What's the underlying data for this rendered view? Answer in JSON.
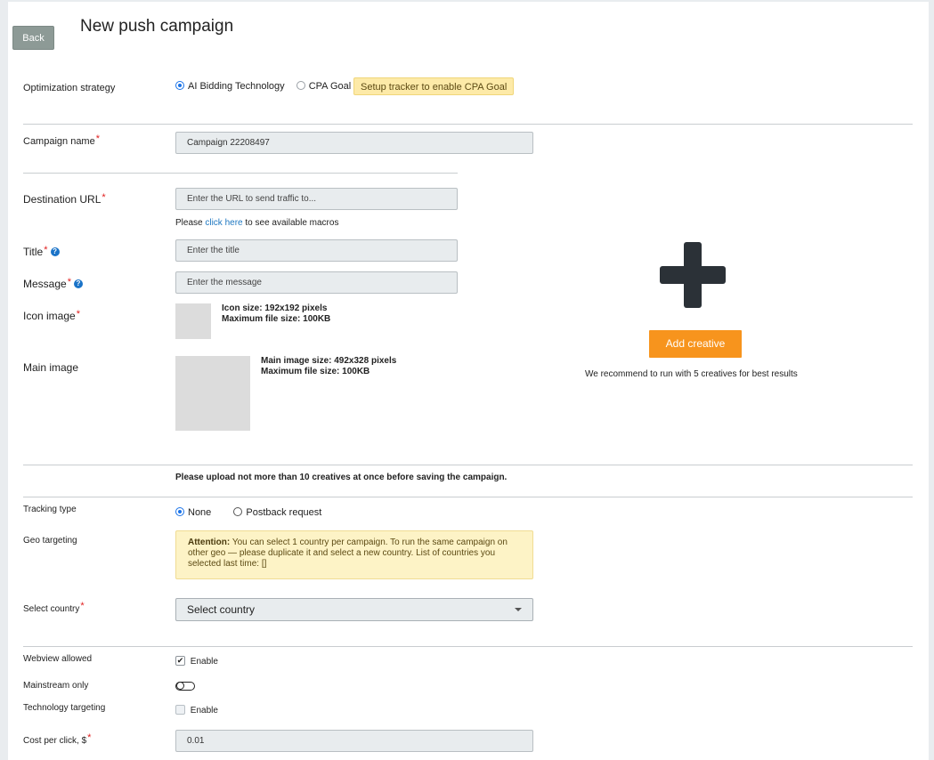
{
  "page": {
    "title": "New push campaign",
    "back_label": "Back"
  },
  "optimization": {
    "label": "Optimization strategy",
    "options": [
      "AI Bidding Technology",
      "CPA Goal"
    ],
    "selected": "AI Bidding Technology",
    "notice": "Setup tracker to enable CPA Goal"
  },
  "campaign_name": {
    "label": "Campaign name",
    "value": "Campaign 22208497"
  },
  "destination_url": {
    "label": "Destination URL",
    "placeholder": "Enter the URL to send traffic to...",
    "macros_prefix": "Please",
    "macros_link": "click here",
    "macros_suffix": "to see available macros"
  },
  "title_field": {
    "label": "Title",
    "placeholder": "Enter the title"
  },
  "message_field": {
    "label": "Message",
    "placeholder": "Enter the message"
  },
  "icon_image": {
    "label": "Icon image",
    "size_text": "Icon size: 192x192 pixels",
    "max_text": "Maximum file size: 100KB"
  },
  "main_image": {
    "label": "Main image",
    "size_text": "Main image size: 492x328 pixels",
    "max_text": "Maximum file size: 100KB"
  },
  "creative": {
    "add_label": "Add creative",
    "recommendation": "We recommend to run with 5 creatives for best results"
  },
  "upload_note": "Please upload not more than 10 creatives at once before saving the campaign.",
  "tracking": {
    "label": "Tracking type",
    "options": [
      "None",
      "Postback request"
    ],
    "selected": "None"
  },
  "geo": {
    "label": "Geo targeting",
    "attention_label": "Attention:",
    "attention_text": "You can select 1 country per campaign. To run the same campaign on other geo — please duplicate it and select a new country. List of countries you selected last time: []"
  },
  "country": {
    "label": "Select country",
    "value": "Select country"
  },
  "webview": {
    "label": "Webview allowed",
    "checkbox_label": "Enable",
    "checked": true
  },
  "mainstream": {
    "label": "Mainstream only",
    "enabled": false
  },
  "technology": {
    "label": "Technology targeting",
    "checkbox_label": "Enable",
    "checked": false
  },
  "cpc": {
    "label": "Cost per click, $",
    "value": "0.01"
  },
  "colors": {
    "accent": "#f7941d",
    "link": "#1f78c1",
    "required": "#e01e1e"
  }
}
